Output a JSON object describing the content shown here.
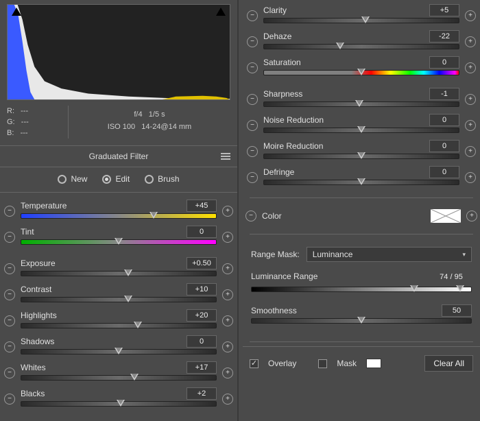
{
  "info": {
    "r_label": "R:",
    "g_label": "G:",
    "b_label": "B:",
    "r_val": "---",
    "g_val": "---",
    "b_val": "---",
    "aperture": "f/4",
    "shutter": "1/5 s",
    "iso": "ISO 100",
    "focal": "14-24@14 mm"
  },
  "panel": {
    "title": "Graduated Filter"
  },
  "modes": {
    "new": "New",
    "edit": "Edit",
    "brush": "Brush",
    "selected": "edit"
  },
  "left_sliders": [
    {
      "label": "Temperature",
      "value": "+45",
      "pos": 68,
      "track": "temp"
    },
    {
      "label": "Tint",
      "value": "0",
      "pos": 50,
      "track": "tint"
    },
    {
      "_gap": true
    },
    {
      "label": "Exposure",
      "value": "+0.50",
      "pos": 55
    },
    {
      "label": "Contrast",
      "value": "+10",
      "pos": 55
    },
    {
      "label": "Highlights",
      "value": "+20",
      "pos": 60
    },
    {
      "label": "Shadows",
      "value": "0",
      "pos": 50
    },
    {
      "label": "Whites",
      "value": "+17",
      "pos": 58
    },
    {
      "label": "Blacks",
      "value": "+2",
      "pos": 51
    }
  ],
  "right_sliders": [
    {
      "label": "Clarity",
      "value": "+5",
      "pos": 52
    },
    {
      "label": "Dehaze",
      "value": "-22",
      "pos": 39
    },
    {
      "label": "Saturation",
      "value": "0",
      "pos": 50,
      "track": "sat"
    },
    {
      "_gap": true
    },
    {
      "label": "Sharpness",
      "value": "-1",
      "pos": 49
    },
    {
      "label": "Noise Reduction",
      "value": "0",
      "pos": 50
    },
    {
      "label": "Moire Reduction",
      "value": "0",
      "pos": 50
    },
    {
      "label": "Defringe",
      "value": "0",
      "pos": 50
    }
  ],
  "color": {
    "label": "Color"
  },
  "range_mask": {
    "label": "Range Mask:",
    "selected": "Luminance"
  },
  "lum_range": {
    "label": "Luminance Range",
    "value": "74 / 95",
    "lo": 74,
    "hi": 95
  },
  "smoothness": {
    "label": "Smoothness",
    "value": "50",
    "pos": 50
  },
  "bottom": {
    "overlay": "Overlay",
    "overlay_on": true,
    "mask": "Mask",
    "mask_on": false,
    "clear": "Clear All"
  }
}
